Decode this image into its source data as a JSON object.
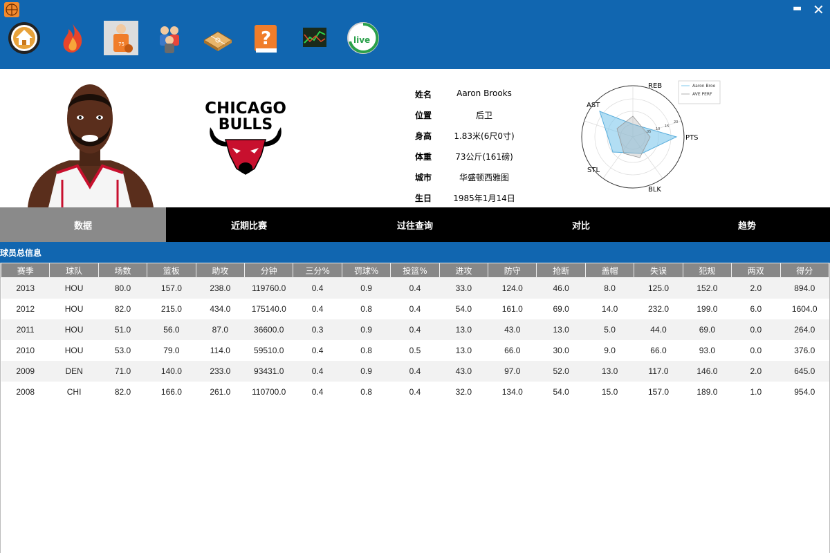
{
  "window": {
    "minimize_label": "▬",
    "close_label": "✕"
  },
  "nav": {
    "items": [
      "home-icon",
      "fire-icon",
      "player-icon",
      "team-icon",
      "court-icon",
      "help-book-icon",
      "stock-chart-icon",
      "live-icon"
    ],
    "live_label": "live",
    "jersey_number": "75"
  },
  "logo": {
    "line1": "CHICAGO",
    "line2": "BULLS"
  },
  "player": {
    "name_label": "姓名",
    "name": "Aaron Brooks",
    "position_label": "位置",
    "position": "后卫",
    "height_label": "身高",
    "height": "1.83米(6尺0寸)",
    "weight_label": "体重",
    "weight": "73公斤(161磅)",
    "city_label": "城市",
    "city": "华盛顿西雅图",
    "birthday_label": "生日",
    "birthday": "1985年1月14日"
  },
  "radar": {
    "axes": [
      "REB",
      "PTS",
      "BLK",
      "STL",
      "AST"
    ],
    "ticks": [
      "05",
      "10",
      "15",
      "20"
    ],
    "legend": [
      "Aaron Broo",
      "AVE PERF"
    ],
    "colors": {
      "player": "#7ec8ec",
      "average": "#b0b0b0"
    }
  },
  "tabs": [
    "数据",
    "近期比赛",
    "过往查询",
    "对比",
    "趋势"
  ],
  "section_title": "球员总信息",
  "table": {
    "headers": [
      "赛季",
      "球队",
      "场数",
      "篮板",
      "助攻",
      "分钟",
      "三分%",
      "罚球%",
      "投篮%",
      "进攻",
      "防守",
      "抢断",
      "盖帽",
      "失误",
      "犯规",
      "两双",
      "得分"
    ],
    "rows": [
      [
        "2013",
        "HOU",
        "80.0",
        "157.0",
        "238.0",
        "119760.0",
        "0.4",
        "0.9",
        "0.4",
        "33.0",
        "124.0",
        "46.0",
        "8.0",
        "125.0",
        "152.0",
        "2.0",
        "894.0"
      ],
      [
        "2012",
        "HOU",
        "82.0",
        "215.0",
        "434.0",
        "175140.0",
        "0.4",
        "0.8",
        "0.4",
        "54.0",
        "161.0",
        "69.0",
        "14.0",
        "232.0",
        "199.0",
        "6.0",
        "1604.0"
      ],
      [
        "2011",
        "HOU",
        "51.0",
        "56.0",
        "87.0",
        "36600.0",
        "0.3",
        "0.9",
        "0.4",
        "13.0",
        "43.0",
        "13.0",
        "5.0",
        "44.0",
        "69.0",
        "0.0",
        "264.0"
      ],
      [
        "2010",
        "HOU",
        "53.0",
        "79.0",
        "114.0",
        "59510.0",
        "0.4",
        "0.8",
        "0.5",
        "13.0",
        "66.0",
        "30.0",
        "9.0",
        "66.0",
        "93.0",
        "0.0",
        "376.0"
      ],
      [
        "2009",
        "DEN",
        "71.0",
        "140.0",
        "233.0",
        "93431.0",
        "0.4",
        "0.9",
        "0.4",
        "43.0",
        "97.0",
        "52.0",
        "13.0",
        "117.0",
        "146.0",
        "2.0",
        "645.0"
      ],
      [
        "2008",
        "CHI",
        "82.0",
        "166.0",
        "261.0",
        "110700.0",
        "0.4",
        "0.8",
        "0.4",
        "32.0",
        "134.0",
        "54.0",
        "15.0",
        "157.0",
        "189.0",
        "1.0",
        "954.0"
      ]
    ]
  },
  "colors": {
    "primary": "#1166b0",
    "tab_active": "#8a8a8a",
    "tab_bar": "#000000",
    "table_header": "#888888"
  }
}
